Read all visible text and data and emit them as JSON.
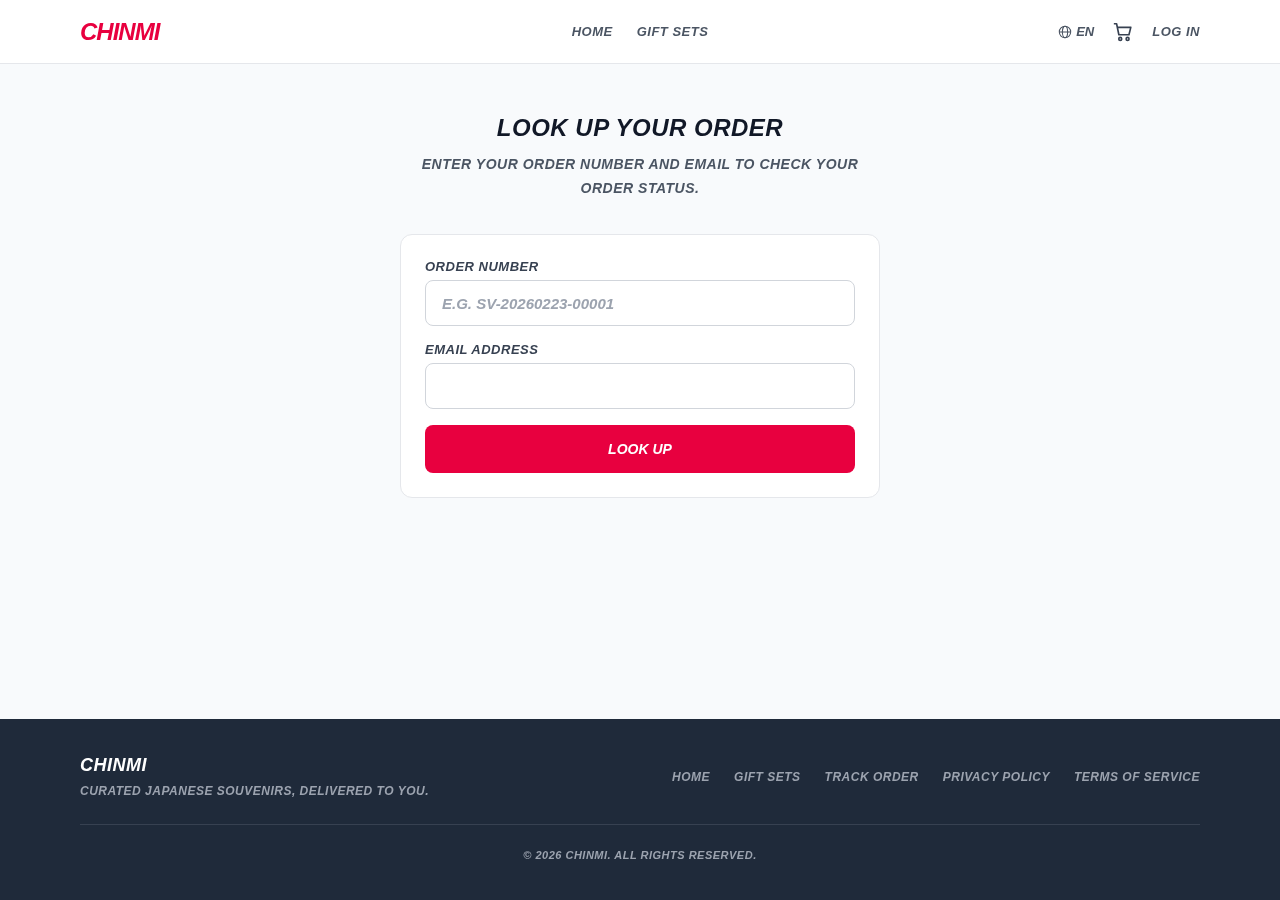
{
  "header": {
    "logo": "CHINMI",
    "nav": [
      {
        "label": "HOME"
      },
      {
        "label": "GIFT SETS"
      }
    ],
    "language": "EN",
    "login": "LOG IN"
  },
  "lookup": {
    "title": "LOOK UP YOUR ORDER",
    "subtitle": "ENTER YOUR ORDER NUMBER AND EMAIL TO CHECK YOUR ORDER STATUS.",
    "fields": [
      {
        "label": "ORDER NUMBER",
        "placeholder": "E.G. SV-20260223-00001"
      },
      {
        "label": "EMAIL ADDRESS"
      }
    ],
    "button": "LOOK UP"
  },
  "footer": {
    "logo": "CHINMI",
    "tagline": "CURATED JAPANESE SOUVENIRS, DELIVERED TO YOU.",
    "links": [
      {
        "label": "HOME"
      },
      {
        "label": "GIFT SETS"
      },
      {
        "label": "TRACK ORDER"
      },
      {
        "label": "PRIVACY POLICY"
      },
      {
        "label": "TERMS OF SERVICE"
      }
    ],
    "copyright": "© 2026 CHINMI. ALL RIGHTS RESERVED."
  }
}
